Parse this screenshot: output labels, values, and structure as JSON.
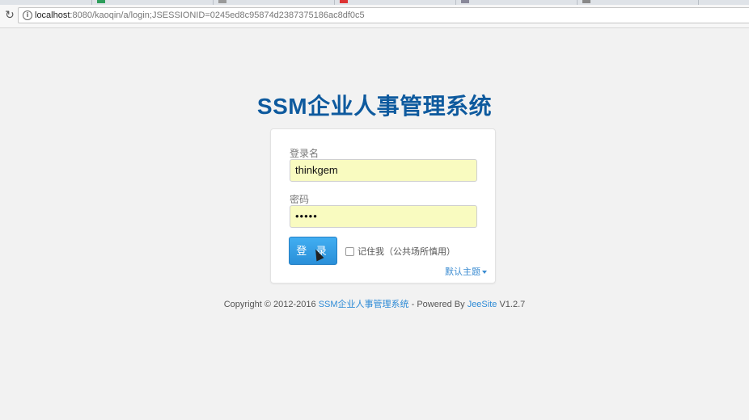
{
  "browser": {
    "url_host": "localhost",
    "url_rest": ":8080/kaoqin/a/login;JSESSIONID=0245ed8c95874d2387375186ac8df0c5",
    "reload_icon": "reload-icon",
    "info_icon": "info-icon"
  },
  "login": {
    "title": "SSM企业人事管理系统",
    "username_label": "登录名",
    "username_value": "thinkgem",
    "password_label": "密码",
    "password_value": "•••••",
    "login_button": "登 录",
    "remember_me": "记住我（公共场所慎用）",
    "theme_link": "默认主题"
  },
  "footer": {
    "prefix": "Copyright © 2012-2016 ",
    "system_link": "SSM企业人事管理系统",
    "middle": " - Powered By ",
    "jeesite_link": "JeeSite",
    "version": " V1.2.7"
  },
  "colors": {
    "title": "#0e5a9e",
    "button": "#2a8fd8",
    "autofill": "#f9fbc0",
    "link": "#2e8bd6"
  }
}
